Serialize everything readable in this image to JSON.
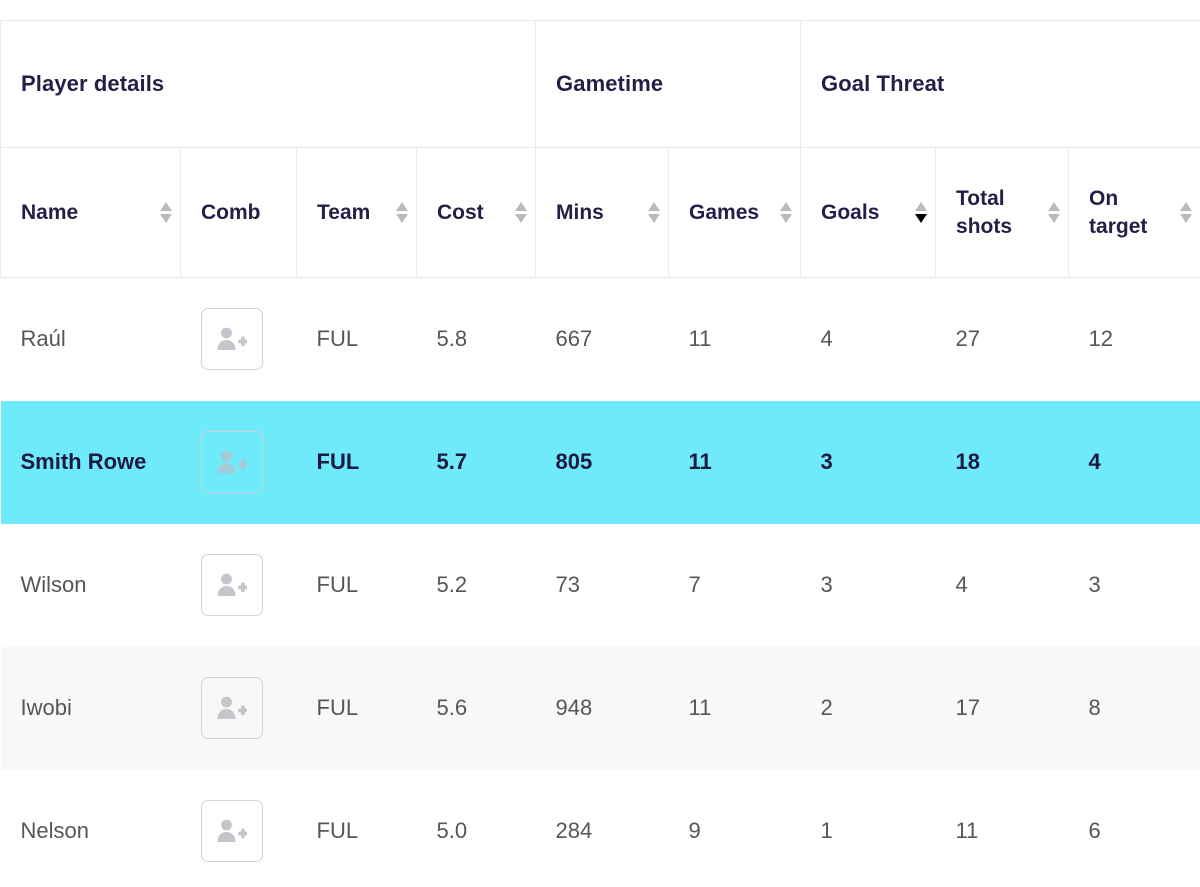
{
  "table": {
    "group_headers": [
      {
        "label": "Player details",
        "span": 4,
        "name": "group-player-details"
      },
      {
        "label": "Gametime",
        "span": 2,
        "name": "group-gametime"
      },
      {
        "label": "Goal Threat",
        "span": 3,
        "name": "group-goal-threat"
      }
    ],
    "columns": [
      {
        "key": "name",
        "label": "Name",
        "sortable": true,
        "sort": "none",
        "align": "left"
      },
      {
        "key": "comb",
        "label": "Comb",
        "sortable": false,
        "sort": "none",
        "align": "left"
      },
      {
        "key": "team",
        "label": "Team",
        "sortable": true,
        "sort": "none",
        "align": "left"
      },
      {
        "key": "cost",
        "label": "Cost",
        "sortable": true,
        "sort": "none",
        "align": "left"
      },
      {
        "key": "mins",
        "label": "Mins",
        "sortable": true,
        "sort": "none",
        "align": "left"
      },
      {
        "key": "games",
        "label": "Games",
        "sortable": true,
        "sort": "none",
        "align": "left"
      },
      {
        "key": "goals",
        "label": "Goals",
        "sortable": true,
        "sort": "desc",
        "align": "left"
      },
      {
        "key": "total_shots",
        "label": "Total shots",
        "sortable": true,
        "sort": "none",
        "align": "left"
      },
      {
        "key": "on_target",
        "label": "On target",
        "sortable": true,
        "sort": "none",
        "align": "left"
      }
    ],
    "add_button": {
      "icon": "add-person-icon",
      "aria_label": "Add player to combination"
    },
    "rows": [
      {
        "name": "Raúl",
        "team": "FUL",
        "cost": "5.8",
        "mins": "667",
        "games": "11",
        "goals": "4",
        "total_shots": "27",
        "on_target": "12",
        "state": "normal"
      },
      {
        "name": "Smith Rowe",
        "team": "FUL",
        "cost": "5.7",
        "mins": "805",
        "games": "11",
        "goals": "3",
        "total_shots": "18",
        "on_target": "4",
        "state": "highlight"
      },
      {
        "name": "Wilson",
        "team": "FUL",
        "cost": "5.2",
        "mins": "73",
        "games": "7",
        "goals": "3",
        "total_shots": "4",
        "on_target": "3",
        "state": "normal"
      },
      {
        "name": "Iwobi",
        "team": "FUL",
        "cost": "5.6",
        "mins": "948",
        "games": "11",
        "goals": "2",
        "total_shots": "17",
        "on_target": "8",
        "state": "stripe"
      },
      {
        "name": "Nelson",
        "team": "FUL",
        "cost": "5.0",
        "mins": "284",
        "games": "9",
        "goals": "1",
        "total_shots": "11",
        "on_target": "6",
        "state": "normal"
      }
    ]
  },
  "colors": {
    "highlight_row": "#6EEAFB",
    "stripe_row": "#F8F8F9",
    "header_text": "#241F48",
    "body_text": "#55565A",
    "border": "#E9EAEC",
    "sort_inactive": "#B9BABD",
    "sort_active": "#000000"
  }
}
